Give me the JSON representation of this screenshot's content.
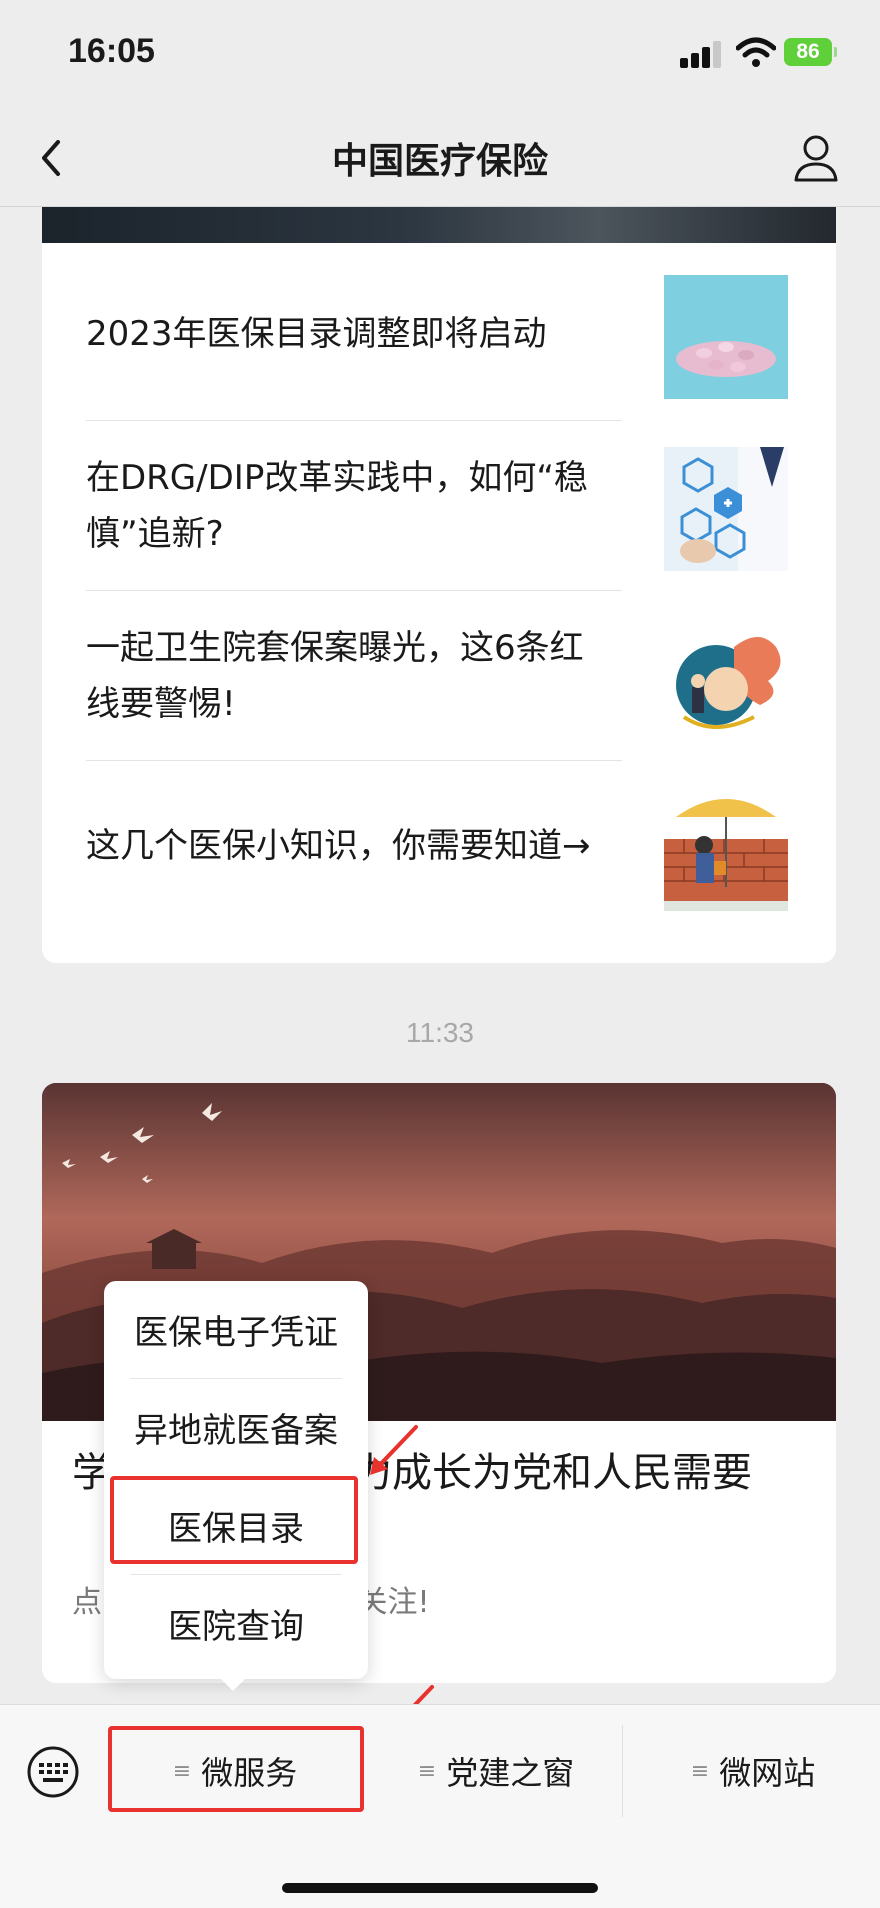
{
  "status_bar": {
    "time": "16:05",
    "battery": "86"
  },
  "nav": {
    "title": "中国医疗保险",
    "back_icon": "chevron-left-icon",
    "profile_icon": "person-icon"
  },
  "feed": {
    "articles": [
      {
        "title": "2023年医保目录调整即将启动"
      },
      {
        "title": "在DRG/DIP改革实践中，如何“稳慎”追新?"
      },
      {
        "title": "一起卫生院套保案曝光，这6条红线要警惕!"
      },
      {
        "title": "这几个医保小知识，你需要知道→"
      }
    ],
    "timestamp": "11:33",
    "card2": {
      "title": "学　　　　　努力成长为党和人民需要",
      "subtitle": "点　　　　　　”即可关注!"
    }
  },
  "popup_menu": {
    "items": [
      "医保电子凭证",
      "异地就医备案",
      "医保目录",
      "医院查询"
    ],
    "highlighted": "医保目录"
  },
  "bottom_menu": {
    "tabs": [
      "微服务",
      "党建之窗",
      "微网站"
    ],
    "highlighted": "微服务",
    "menu_glyph": "≡",
    "keyboard_icon": "keyboard-icon"
  },
  "annotation_color": "#e8322d"
}
